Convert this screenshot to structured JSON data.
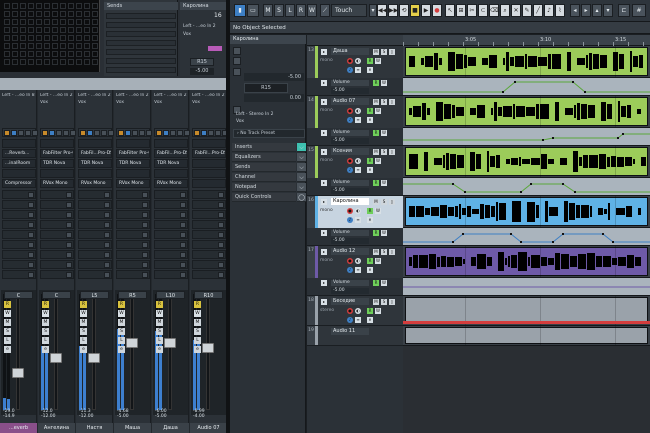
{
  "colors": {
    "green": "#9ccc5a",
    "blue": "#5fb2e6",
    "purple": "#6e5aa8",
    "grey": "#9aa2aa",
    "teal": "#3ec0b0",
    "orange": "#c88a2a",
    "pink": "#b85bb8"
  },
  "mixer_top": {
    "sends_header": "Sends",
    "channel_name": "Каролина",
    "channel_number": "16",
    "routing": "Left - ...eo In 2",
    "output": "Vox",
    "pan": "R15",
    "volume": "-5.00"
  },
  "strips": [
    {
      "routing": "Left - ...eo In 8",
      "insert1": "",
      "insert2": "...Reverb...",
      "insert3": "...inalRoom",
      "insert4": "",
      "insert5": "Compressor",
      "pan": "C",
      "vol": "-29.0",
      "vol2": "-14.9",
      "name": "...everb",
      "level": 0.1,
      "fader": 0.3
    },
    {
      "routing": "Left - ...eo In 2",
      "output": "Vox",
      "insert1": "",
      "insert2": "FabFilter Pro-Q",
      "insert3": "TDR Nova",
      "insert4": "",
      "insert5": "RVox Mono",
      "pan": "C",
      "vol": "-12.0",
      "vol2": "-12.00",
      "name": "Ангелина",
      "level": 0.55,
      "fader": 0.45
    },
    {
      "routing": "Left - ...eo In 2",
      "output": "Vox",
      "insert1": "",
      "insert2": "FabFil...Pro-DS",
      "insert3": "TDR Nova",
      "insert4": "",
      "insert5": "RVox Mono",
      "pan": "L5",
      "vol": "-11.3",
      "vol2": "-12.00",
      "name": "Настя",
      "level": 0.55,
      "fader": 0.45
    },
    {
      "routing": "Left - ...eo In 2",
      "output": "Vox",
      "insert1": "",
      "insert2": "FabFilter Pro-Q",
      "insert3": "TDR Nova",
      "insert4": "",
      "insert5": "RVox Mono",
      "pan": "R5",
      "vol": "-4.68",
      "vol2": "-5.00",
      "name": "Маша",
      "level": 0.7,
      "fader": 0.6
    },
    {
      "routing": "Left - ...eo In 2",
      "output": "Vox",
      "insert1": "",
      "insert2": "FabFil...Pro-DS",
      "insert3": "TDR Nova",
      "insert4": "",
      "insert5": "RVox Mono",
      "pan": "L10",
      "vol": "-6.00",
      "vol2": "-5.00",
      "name": "Даша",
      "level": 0.68,
      "fader": 0.6
    },
    {
      "routing": "Left - ...eo In 2",
      "output": "Vox",
      "insert1": "",
      "insert2": "FabFil...Pro-DS",
      "insert3": "",
      "insert4": "",
      "insert5": "",
      "pan": "R10",
      "vol": "-8.99",
      "vol2": "-4.00",
      "name": "Audio 07",
      "level": 0.6,
      "fader": 0.55
    }
  ],
  "toolbar": {
    "automation_mode": "Touch",
    "info": "No Object Selected"
  },
  "inspector": {
    "track_name": "Каролина",
    "volume": "-5.00",
    "pan": "R15",
    "pan_value": "0.00",
    "routing_in": "Left - Stereo In 2",
    "routing_out": "Vox",
    "preset": "No Track Preset",
    "sections": [
      "Inserts",
      "Equalizers",
      "Sends",
      "Channel",
      "Notepad",
      "Quick Controls"
    ]
  },
  "ruler": {
    "labels": [
      "3:05",
      "3:10",
      "3:15"
    ]
  },
  "tracks": [
    {
      "num": "13",
      "name": "Даша",
      "color": "#9ccc5a",
      "mono": "mono",
      "selected": false,
      "auto_label": "Volume",
      "auto_value": "-5.00"
    },
    {
      "num": "14",
      "name": "Audio 07",
      "color": "#9ccc5a",
      "mono": "mono",
      "selected": false,
      "auto_label": "Volume",
      "auto_value": "-5.00"
    },
    {
      "num": "15",
      "name": "Ксения",
      "color": "#9ccc5a",
      "mono": "mono",
      "selected": false,
      "auto_label": "Volume",
      "auto_value": "-5.00"
    },
    {
      "num": "16",
      "name": "Каролина",
      "color": "#5fb2e6",
      "mono": "mono",
      "selected": true,
      "auto_label": "Volume",
      "auto_value": "-5.00"
    },
    {
      "num": "17",
      "name": "Audio 12",
      "color": "#6e5aa8",
      "mono": "mono",
      "selected": false,
      "auto_label": "Volume",
      "auto_value": "-5.00"
    },
    {
      "num": "18",
      "name": "Беседие",
      "color": "#9aa2aa",
      "mono": "stereo",
      "selected": false
    },
    {
      "num": "19",
      "name": "Audio 11",
      "color": "#9aa2aa",
      "mono": "",
      "selected": false
    }
  ]
}
